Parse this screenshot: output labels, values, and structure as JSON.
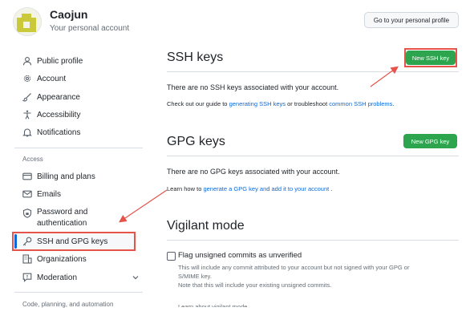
{
  "header": {
    "username": "Caojun",
    "subtitle": "Your personal account",
    "profile_button": "Go to your personal profile"
  },
  "sidebar": {
    "items": [
      {
        "label": "Public profile",
        "icon": "person-icon"
      },
      {
        "label": "Account",
        "icon": "gear-icon"
      },
      {
        "label": "Appearance",
        "icon": "paintbrush-icon"
      },
      {
        "label": "Accessibility",
        "icon": "accessibility-icon"
      },
      {
        "label": "Notifications",
        "icon": "bell-icon"
      }
    ],
    "access_heading": "Access",
    "access_items": [
      {
        "label": "Billing and plans",
        "icon": "credit-card-icon"
      },
      {
        "label": "Emails",
        "icon": "mail-icon"
      },
      {
        "label": "Password and",
        "label2": "authentication",
        "icon": "shield-lock-icon"
      },
      {
        "label": "SSH and GPG keys",
        "icon": "key-icon",
        "active": true
      },
      {
        "label": "Organizations",
        "icon": "organization-icon"
      },
      {
        "label": "Moderation",
        "icon": "report-icon"
      }
    ],
    "code_heading": "Code, planning, and automation"
  },
  "ssh": {
    "title": "SSH keys",
    "new_button": "New SSH key",
    "empty_text": "There are no SSH keys associated with your account.",
    "guide_prefix": "Check out our guide to ",
    "guide_link": "generating SSH keys",
    "guide_mid": " or troubleshoot ",
    "guide_link2": "common SSH problems",
    "guide_suffix": "."
  },
  "gpg": {
    "title": "GPG keys",
    "new_button": "New GPG key",
    "empty_text": "There are no GPG keys associated with your account.",
    "learn_prefix": "Learn how to ",
    "learn_link": "generate a GPG key and add it to your account",
    "learn_suffix": " ."
  },
  "vigilant": {
    "title": "Vigilant mode",
    "checkbox_label": "Flag unsigned commits as unverified",
    "help_line1": "This will include any commit attributed to your account but not signed with your GPG or",
    "help_line2": "S/MIME key.",
    "help_line3": "Note that this will include your existing unsigned commits.",
    "learn_link": "Learn about vigilant mode",
    "checked": false
  },
  "colors": {
    "primary_green": "#2da44e",
    "link_blue": "#0969da",
    "annotation_red": "#e5534b"
  }
}
